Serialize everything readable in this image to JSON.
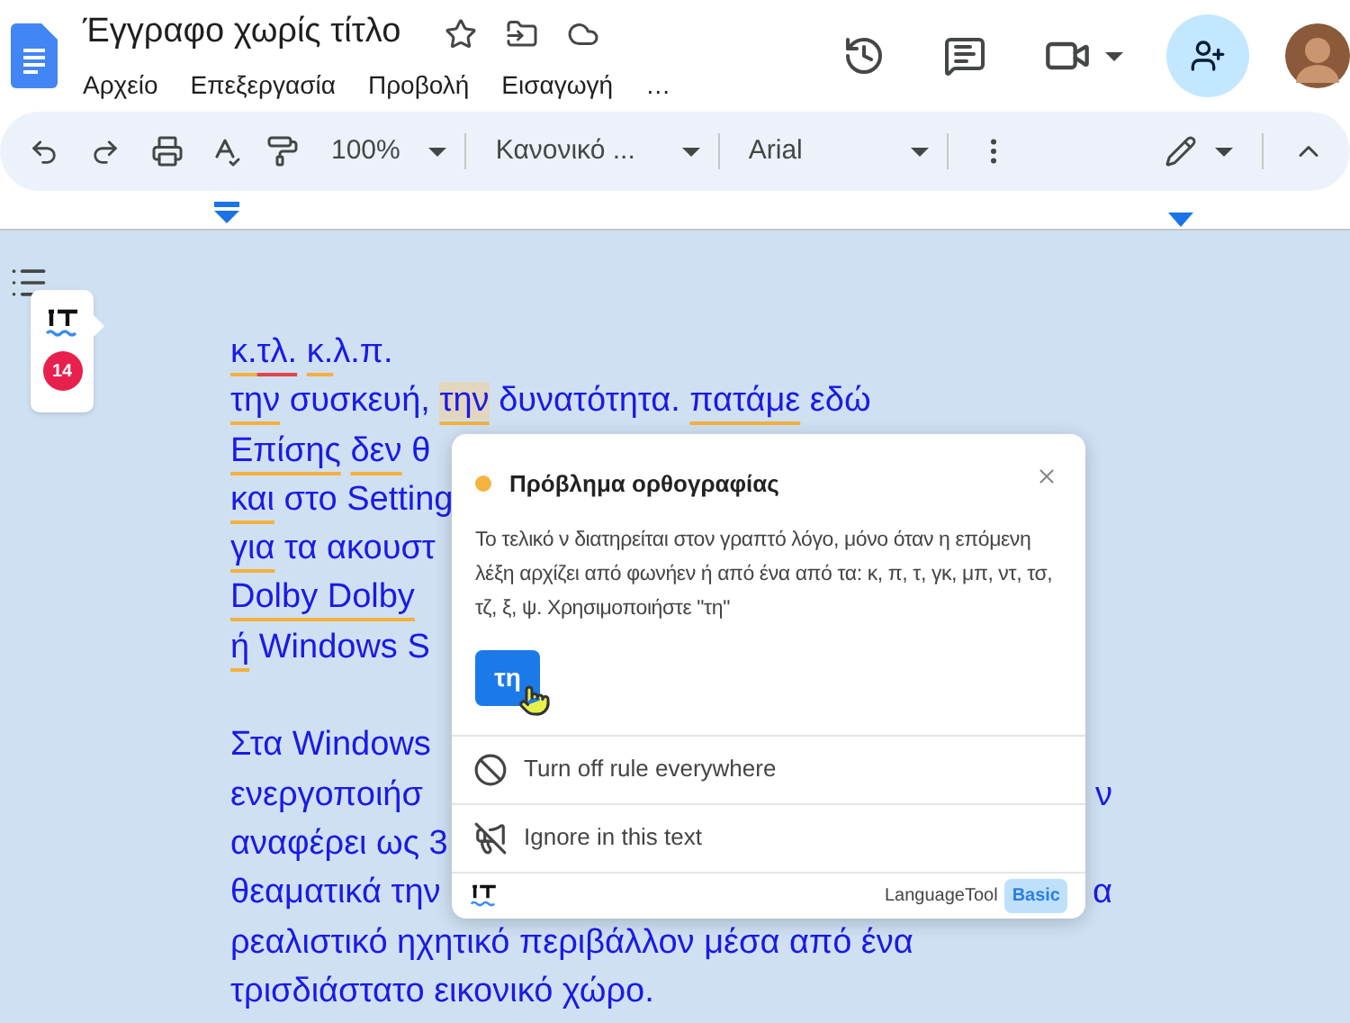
{
  "document_title": "Έγγραφο χωρίς τίτλο",
  "menu": [
    "Αρχείο",
    "Επεξεργασία",
    "Προβολή",
    "Εισαγωγή",
    "…"
  ],
  "toolbar": {
    "zoom": "100%",
    "style": "Κανονικό ...",
    "font": "Arial"
  },
  "lt_widget": {
    "count": "14"
  },
  "paragraphs": [
    {
      "lines": [
        {
          "left": [
            {
              "t": "κ.",
              "kind": "grammar"
            },
            {
              "t": "τλ.",
              "kind": "spelling"
            },
            {
              "t": " κ.",
              "kind": "grammar"
            },
            {
              "t": "λ.π.",
              "kind": "plain"
            }
          ]
        },
        {
          "left": [
            {
              "t": "την",
              "kind": "grammar",
              "selected": false
            },
            {
              "t": " συσκευή, ",
              "kind": "plain"
            },
            {
              "t": "την",
              "kind": "grammar",
              "selected": true
            },
            {
              "t": " δυνατότητα. ",
              "kind": "plain"
            },
            {
              "t": "πατάμε",
              "kind": "grammar",
              "selected": false
            },
            {
              "t": " εδώ",
              "kind": "plain"
            }
          ]
        },
        {
          "left": [
            {
              "t": "Επίσης",
              "kind": "grammar"
            },
            {
              "t": " δεν",
              "kind": "grammar"
            },
            {
              "t": " θ",
              "kind": "plain"
            }
          ]
        },
        {
          "left": [
            {
              "t": "και",
              "kind": "grammar"
            },
            {
              "t": " στο Setting",
              "kind": "plain"
            }
          ]
        },
        {
          "left": [
            {
              "t": "για",
              "kind": "grammar"
            },
            {
              "t": " τα ακουστ",
              "kind": "plain"
            }
          ]
        },
        {
          "left": [
            {
              "t": "Dolby Dolby",
              "kind": "grammar"
            }
          ]
        },
        {
          "left": [
            {
              "t": "ή",
              "kind": "grammar"
            },
            {
              "t": " Windows S",
              "kind": "plain"
            }
          ]
        }
      ]
    },
    {
      "lines": [
        {
          "left": [
            {
              "t": "Στα Windows",
              "kind": "plain"
            }
          ]
        },
        {
          "left": [
            {
              "t": "ενεργοποιήσ",
              "kind": "plain"
            }
          ],
          "right": "ν"
        },
        {
          "left": [
            {
              "t": "αναφέρει ως 3",
              "kind": "plain"
            }
          ]
        },
        {
          "left": [
            {
              "t": "θεαματικά την",
              "kind": "plain"
            }
          ],
          "right": "α"
        },
        {
          "left": [
            {
              "t": "ρεαλιστικό ηχητικό περιβάλλον μέσα από ένα",
              "kind": "plain"
            }
          ]
        },
        {
          "left": [
            {
              "t": "τρισδιάστατο εικονικό χώρο.",
              "kind": "plain"
            }
          ]
        }
      ]
    }
  ],
  "popup": {
    "title": "Πρόβλημα ορθογραφίας",
    "color": "#f5b342",
    "description": "Το τελικό ν διατηρείται στον γραπτό λόγο, μόνο όταν η επόμενη λέξη αρχίζει από φωνήεν ή από ένα από τα: κ, π, τ, γκ, μπ, ντ, τσ, τζ, ξ, ψ. Χρησιμοποιήστε \"τη\"",
    "suggestion": "τη",
    "actions": [
      {
        "kind": "disable",
        "label": "Turn off rule everywhere"
      },
      {
        "kind": "ignore",
        "label": "Ignore in this text"
      }
    ],
    "brand": "LanguageTool",
    "plan": "Basic"
  }
}
